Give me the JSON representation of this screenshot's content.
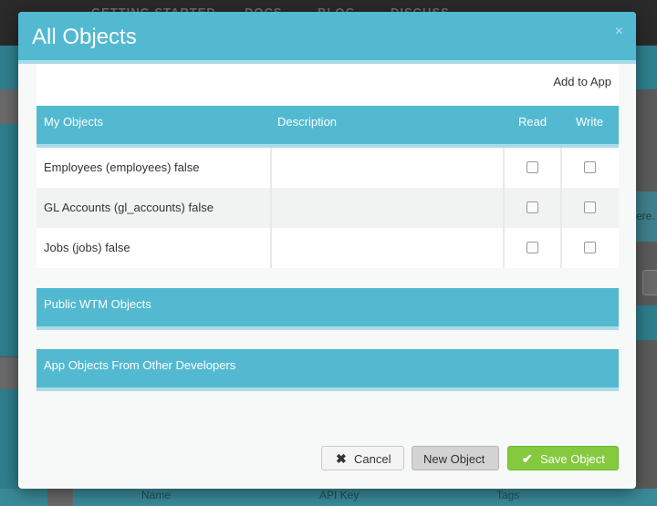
{
  "background": {
    "nav_items": [
      "GETTING STARTED",
      "DOCS",
      "BLOG",
      "DISCUSS"
    ],
    "right_text": "ere.",
    "bottom_labels": [
      "Name",
      "API Key",
      "Tags"
    ]
  },
  "modal": {
    "title": "All Objects",
    "close_icon": "×",
    "add_to_app_label": "Add to App",
    "table": {
      "headers": {
        "name": "My Objects",
        "description": "Description",
        "read": "Read",
        "write": "Write"
      },
      "rows": [
        {
          "name": "Employees (employees) false",
          "description": "",
          "read": false,
          "write": false
        },
        {
          "name": "GL Accounts (gl_accounts) false",
          "description": "",
          "read": false,
          "write": false
        },
        {
          "name": "Jobs (jobs) false",
          "description": "",
          "read": false,
          "write": false
        }
      ]
    },
    "sections": {
      "public": "Public WTM Objects",
      "app_other": "App Objects From Other Developers"
    },
    "footer": {
      "cancel_label": "Cancel",
      "new_object_label": "New Object",
      "save_label": "Save Object"
    }
  },
  "colors": {
    "header_teal": "#52b9d1",
    "save_green": "#84c93e"
  },
  "icons": {
    "close": "close-icon",
    "cancel": "x-icon",
    "save": "check-icon"
  }
}
